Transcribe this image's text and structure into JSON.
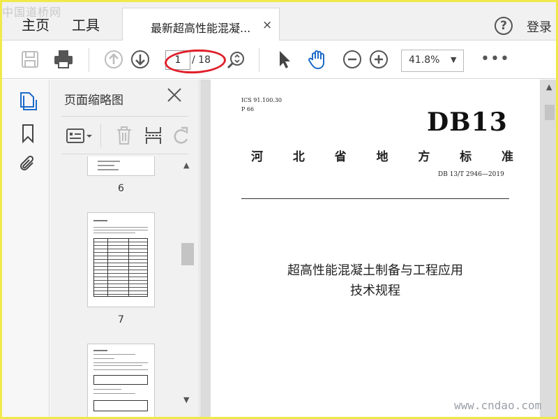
{
  "watermarks": {
    "top": "中国道桥网",
    "bottom": "www.cndao.com"
  },
  "tabbar": {
    "home": "主页",
    "tools": "工具",
    "doc_tab_title": "最新超高性能混凝...",
    "doc_tab_close": "×",
    "help": "?",
    "login": "登录"
  },
  "toolbar": {
    "current_page": "1",
    "total_pages": "/ 18",
    "zoom": "41.8%",
    "more": "•••",
    "icons": [
      "save-icon",
      "print-icon",
      "page-up-icon",
      "page-down-icon",
      "page-fit-icon",
      "select-cursor-icon",
      "hand-tool-icon",
      "zoom-out-icon",
      "zoom-in-icon",
      "more-icon"
    ]
  },
  "rail": {
    "icons": [
      "page-thumbnails-icon",
      "bookmark-icon",
      "attachment-icon"
    ]
  },
  "panel": {
    "title": "页面缩略图",
    "thumbnails": [
      {
        "label": "6"
      },
      {
        "label": "7"
      }
    ]
  },
  "document": {
    "ics": "ICS  91.100.30",
    "p": "P  66",
    "db": "DB13",
    "province": [
      "河",
      "北",
      "省",
      "地",
      "方",
      "标",
      "准"
    ],
    "number": "DB 13/T  2946—2019",
    "title_line1": "超高性能混凝土制备与工程应用",
    "title_line2": "技术规程"
  },
  "colors": {
    "accent_blue": "#1b6ac9",
    "highlight_red": "#e0202a",
    "outer_border": "#f1e94a"
  }
}
